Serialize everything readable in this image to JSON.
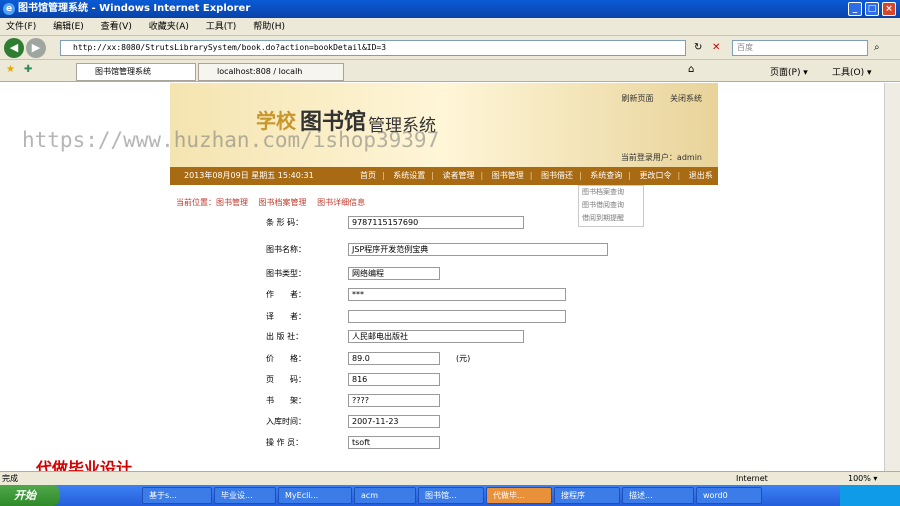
{
  "window": {
    "title": "图书馆管理系统 - Windows Internet Explorer",
    "min": "_",
    "max": "□",
    "close": "×"
  },
  "menu": [
    "文件(F)",
    "编辑(E)",
    "查看(V)",
    "收藏夹(A)",
    "工具(T)",
    "帮助(H)"
  ],
  "address": {
    "url": "http://xx:8080/StrutsLibrarySystem/book.do?action=bookDetail&ID=3",
    "search_placeholder": "百度"
  },
  "tabs": [
    "图书馆管理系统",
    "localhost:808 / localh"
  ],
  "toolbar": {
    "page": "页面(P) ▾",
    "tools": "工具(O) ▾"
  },
  "banner": {
    "school": "学校",
    "library": "图书馆",
    "system": "管理系统",
    "top_links": [
      "刷新页面",
      "关闭系统"
    ],
    "user_label": "当前登录用户：admin"
  },
  "navstrip": {
    "date": "2013年08月09日 星期五 15:40:31",
    "links": [
      "首页",
      "系统设置",
      "读者管理",
      "图书管理",
      "图书借还",
      "系统查询",
      "更改口令",
      "退出系统"
    ]
  },
  "dropdown": [
    "图书档案查询",
    "图书借阅查询",
    "借阅到期提醒"
  ],
  "breadcrumb": [
    "当前位置：图书管理",
    "图书档案管理",
    "图书详细信息"
  ],
  "fields": [
    {
      "label": "条 形 码：",
      "value": "9787115157690"
    },
    {
      "label": "图书名称：",
      "value": "JSP程序开发范例宝典"
    },
    {
      "label": "图书类型：",
      "value": "网络编程"
    },
    {
      "label": "作　　者：",
      "value": "***"
    },
    {
      "label": "译　　者：",
      "value": ""
    },
    {
      "label": "出 版 社：",
      "value": "人民邮电出版社"
    },
    {
      "label": "价　　格：",
      "value": "89.0",
      "unit": "(元)"
    },
    {
      "label": "页　　码：",
      "value": "816"
    },
    {
      "label": "书　　架：",
      "value": "????"
    },
    {
      "label": "入库时间：",
      "value": "2007-11-23"
    },
    {
      "label": "操 作 员：",
      "value": "tsoft"
    }
  ],
  "overlay": {
    "watermark": "https://www.huzhan.com/ishop39397",
    "red_text": "代做毕业设计"
  },
  "statusbar": {
    "left": "完成",
    "zone": "Internet",
    "zoom": "100% ▾"
  },
  "taskbar": {
    "start": "开始",
    "tasks": [
      "基于s...",
      "毕业设...",
      "MyEcli...",
      "acm",
      "图书馆...",
      "代做毕...",
      "搜程序",
      "描述...",
      "word0"
    ],
    "clock": ""
  }
}
